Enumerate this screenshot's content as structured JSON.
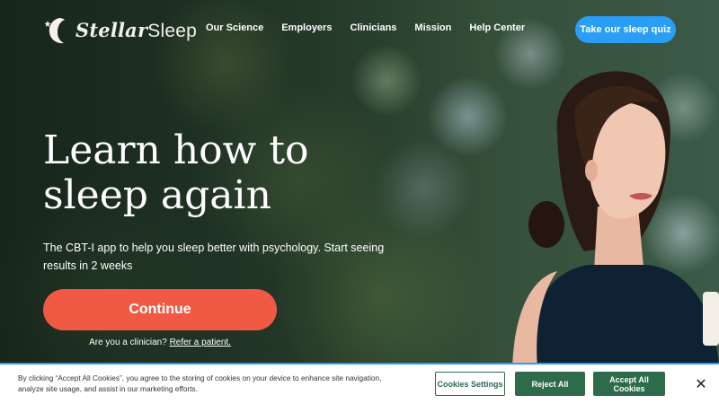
{
  "brand": {
    "name_script": "Stellar",
    "name_plain": "Sleep",
    "logo_icon": "moon-star-icon"
  },
  "nav": {
    "links": [
      "Our Science",
      "Employers",
      "Clinicians",
      "Mission",
      "Help Center"
    ],
    "cta_label": "Take our sleep quiz"
  },
  "hero": {
    "headline_line1": "Learn how to",
    "headline_line2": "sleep again",
    "subtitle": "The CBT-I app to help you sleep better with psychology. Start seeing results in 2 weeks",
    "continue_label": "Continue",
    "clinician_prompt": "Are you a clinician?",
    "clinician_link": "Refer a patient."
  },
  "cookie_banner": {
    "text": "By clicking “Accept All Cookies”, you agree to the storing of cookies on your device to enhance site navigation, analyze site usage, and assist in our marketing efforts.",
    "settings_label": "Cookies Settings",
    "reject_label": "Reject All",
    "accept_label": "Accept All Cookies",
    "close_label": "✕"
  },
  "colors": {
    "accent_blue": "#2a9df4",
    "continue_coral": "#f05a45",
    "cookie_green": "#2d6b4a",
    "logo_cream": "#f4f1e8"
  }
}
